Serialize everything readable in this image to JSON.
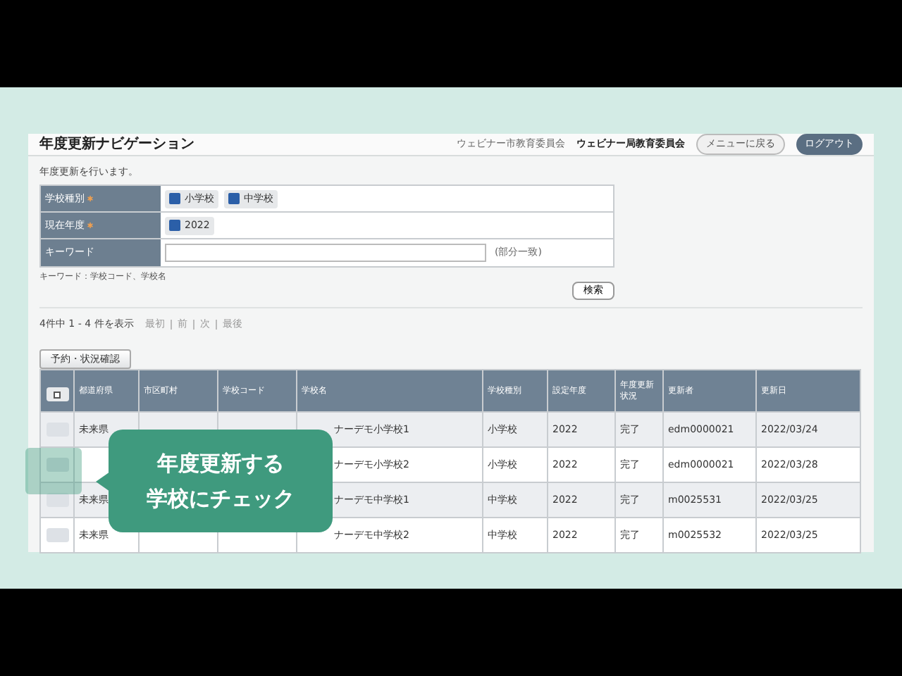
{
  "header": {
    "title": "年度更新ナビゲーション",
    "org_1": "ウェビナー市教育委員会",
    "org_2": "ウェビナー局教育委員会",
    "menu_button": "メニューに戻る",
    "logout_button": "ログアウト"
  },
  "intro": "年度更新を行います。",
  "form": {
    "fields": [
      {
        "label": "学校種別",
        "required": true,
        "kind": "checks",
        "options": [
          {
            "label": "小学校",
            "checked": true
          },
          {
            "label": "中学校",
            "checked": true
          }
        ]
      },
      {
        "label": "現在年度",
        "required": true,
        "kind": "checks",
        "options": [
          {
            "label": "2022",
            "checked": true
          }
        ]
      },
      {
        "label": "キーワード",
        "required": false,
        "kind": "text",
        "hint": "(部分一致)"
      }
    ],
    "note": "キーワード：学校コード、学校名",
    "search_button": "検索"
  },
  "results": {
    "summary": "4件中 1 - 4 件を表示",
    "pager": [
      "最初",
      "前",
      "次",
      "最後"
    ],
    "action_button": "予約・状況確認"
  },
  "table": {
    "select_all_checked": false,
    "columns": [
      "都道府県",
      "市区町村",
      "学校コード",
      "学校名",
      "学校種別",
      "設定年度",
      "年度更新状況",
      "更新者",
      "更新日"
    ],
    "rows": [
      {
        "checked": false,
        "prefecture": "未来県",
        "school_name": "ナーデモ小学校1",
        "school_type": "小学校",
        "year": "2022",
        "status": "完了",
        "updater": "edm0000021",
        "updated": "2022/03/24"
      },
      {
        "checked": false,
        "school_name": "ナーデモ小学校2",
        "school_type": "小学校",
        "year": "2022",
        "status": "完了",
        "updater": "edm0000021",
        "updated": "2022/03/28"
      },
      {
        "checked": false,
        "prefecture": "未来県",
        "school_name": "ナーデモ中学校1",
        "school_type": "中学校",
        "year": "2022",
        "status": "完了",
        "updater": "m0025531",
        "updated": "2022/03/25"
      },
      {
        "checked": false,
        "prefecture": "未来県",
        "school_name": "ナーデモ中学校2",
        "school_type": "中学校",
        "year": "2022",
        "status": "完了",
        "updater": "m0025532",
        "updated": "2022/03/25"
      }
    ]
  },
  "callout": {
    "lines": [
      "年度更新する",
      "学校にチェック"
    ]
  }
}
